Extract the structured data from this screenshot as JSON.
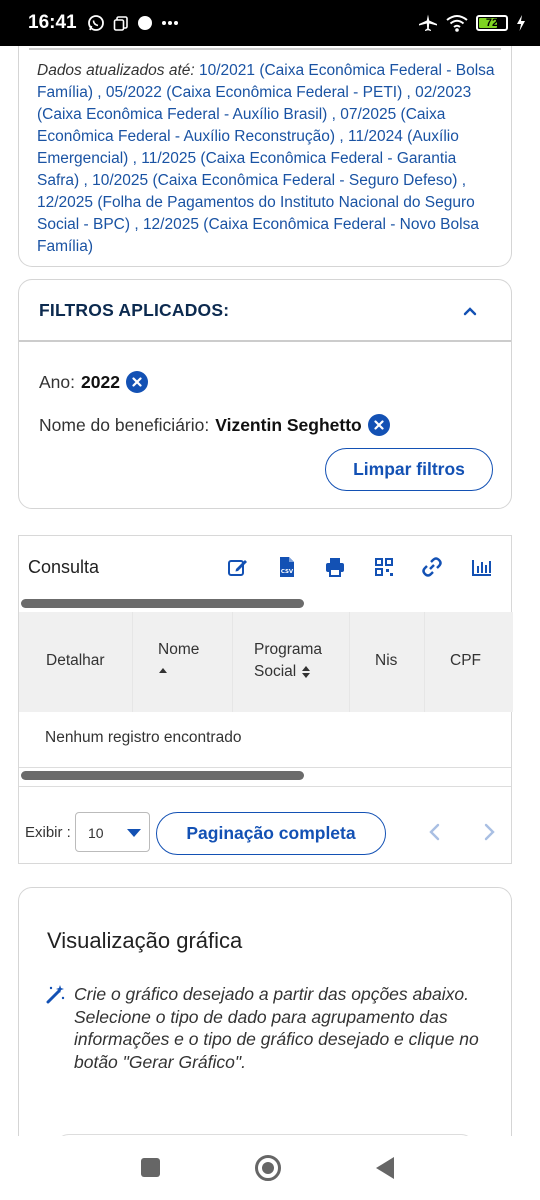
{
  "status": {
    "time": "16:41",
    "battery_level": 72,
    "battery_text": "72"
  },
  "update": {
    "label": "Dados atualizados até:",
    "text": " 10/2021 (Caixa Econômica Federal - Bolsa Família) , 05/2022 (Caixa Econômica Federal - PETI) , 02/2023 (Caixa Econômica Federal - Auxílio Brasil) , 07/2025 (Caixa Econômica Federal - Auxílio Reconstrução) , 11/2024 (Auxílio Emergencial) , 11/2025 (Caixa Econômica Federal - Garantia Safra) , 10/2025 (Caixa Econômica Federal - Seguro Defeso) , 12/2025 (Folha de Pagamentos do Instituto Nacional do Seguro Social - BPC) , 12/2025 (Caixa Econômica Federal - Novo Bolsa Família)"
  },
  "filters": {
    "title": "FILTROS APLICADOS:",
    "items": [
      {
        "label": "Ano:",
        "value": "2022"
      },
      {
        "label": "Nome do beneficiário:",
        "value": "Vizentin Seghetto"
      }
    ],
    "clear_label": "Limpar filtros"
  },
  "consulta": {
    "title": "Consulta",
    "tools": [
      "edit-icon",
      "csv-file-icon",
      "print-icon",
      "qr-code-icon",
      "link-icon",
      "chart-icon"
    ],
    "columns": [
      "Detalhar",
      "Nome",
      "Programa Social",
      "Nis",
      "CPF"
    ],
    "col_programa_line1": "Programa",
    "col_programa_line2": "Social",
    "empty_message": "Nenhum registro encontrado",
    "exibir_label": "Exibir :",
    "page_size": "10",
    "full_pagination_label": "Paginação completa"
  },
  "chart": {
    "title": "Visualização gráfica",
    "desc_line1": "Crie o gráfico desejado a partir das opções abaixo.",
    "desc_line2": "Selecione o tipo de dado para agrupamento das informações e o tipo de gráfico desejado e clique no botão \"Gerar Gráfico\"."
  },
  "colors": {
    "primary": "#1351b4",
    "heading": "#0c2a4f",
    "link": "#1a53a3"
  }
}
